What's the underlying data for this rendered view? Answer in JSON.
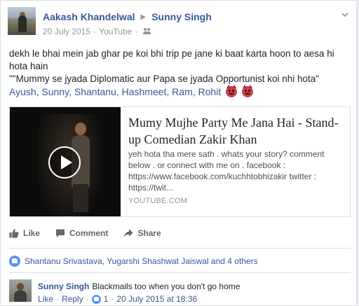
{
  "post": {
    "author": "Aakash Khandelwal",
    "target": "Sunny Singh",
    "date": "20 July 2015",
    "via": "YouTube",
    "text_line1": "dekh le bhai mein jab ghar pe koi bhi trip pe jane ki baat karta hoon to aesa hi hota hain",
    "text_line2": "\"\"Mummy se jyada Diplomatic aur Papa se jyada Opportunist koi nhi hota\"",
    "tags": "Ayush, Sunny, Shantanu, Hashmeet, Ram, Rohit"
  },
  "link_preview": {
    "title": "Mumy Mujhe Party Me Jana Hai - Stand-up Comedian Zakir Khan",
    "description": "yeh hota tha mere sath . whats your story? comment below . or connect with me on . facebook : https://www.facebook.com/kuchhtobhizakir twitter : https://twit...",
    "domain": "YOUTUBE.COM"
  },
  "actions": {
    "like": "Like",
    "comment": "Comment",
    "share": "Share"
  },
  "reactions": {
    "text": "Shantanu Srivastava, Yugarshi Shashwat Jaiswal and 4 others"
  },
  "comment": {
    "author": "Sunny Singh",
    "text": "Blackmails too when you don't go home",
    "like": "Like",
    "reply": "Reply",
    "likes_count": "1",
    "timestamp": "20 July 2015 at 18:36"
  },
  "colors": {
    "link_blue": "#365899",
    "like_blue": "#5890ff",
    "meta_grey": "#90949c"
  }
}
